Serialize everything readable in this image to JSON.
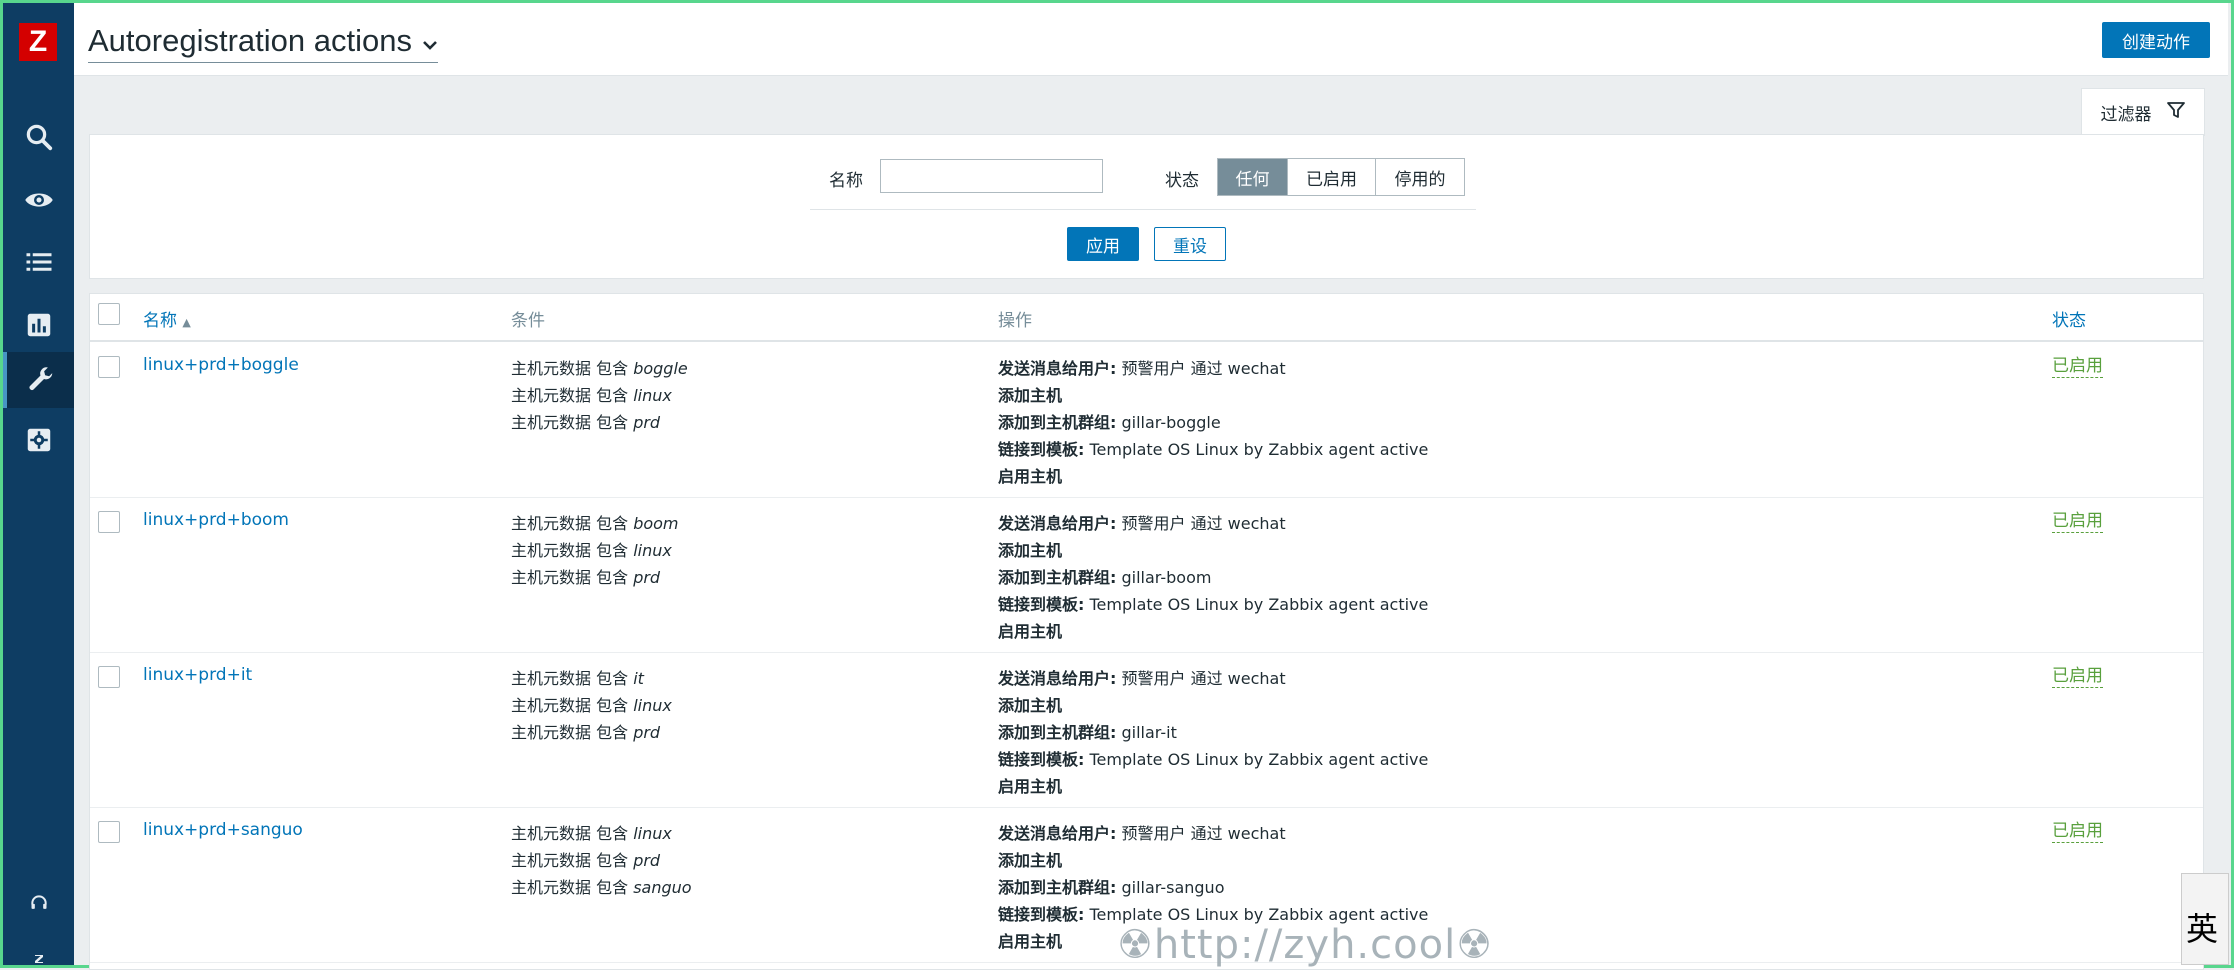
{
  "sidebar": {
    "logo": "Z",
    "items": [
      {
        "icon": "search-icon"
      },
      {
        "icon": "eye-icon"
      },
      {
        "icon": "list-icon"
      },
      {
        "icon": "chart-icon"
      },
      {
        "icon": "wrench-icon",
        "active": true
      },
      {
        "icon": "gear-icon"
      }
    ],
    "bottom": [
      {
        "icon": "headset-icon"
      },
      {
        "icon": "zabbix-icon"
      }
    ]
  },
  "header": {
    "title": "Autoregistration actions",
    "create_label": "创建动作"
  },
  "filter": {
    "tab_label": "过滤器",
    "name_label": "名称",
    "name_value": "",
    "status_label": "状态",
    "status_options": [
      "任何",
      "已启用",
      "停用的"
    ],
    "status_selected": "任何",
    "apply_label": "应用",
    "reset_label": "重设"
  },
  "table": {
    "columns": {
      "name": "名称",
      "conditions": "条件",
      "operations": "操作",
      "status": "状态"
    },
    "rows": [
      {
        "name": "linux+prd+boggle",
        "conditions": [
          {
            "prefix": "主机元数据 包含 ",
            "value": "boggle"
          },
          {
            "prefix": "主机元数据 包含 ",
            "value": "linux"
          },
          {
            "prefix": "主机元数据 包含 ",
            "value": "prd"
          }
        ],
        "operations": [
          {
            "label": "发送消息给用户:",
            "value": " 预警用户 通过 wechat"
          },
          {
            "label": "添加主机",
            "value": ""
          },
          {
            "label": "添加到主机群组:",
            "value": " gillar-boggle"
          },
          {
            "label": "链接到模板:",
            "value": " Template OS Linux by Zabbix agent active"
          },
          {
            "label": "启用主机",
            "value": ""
          }
        ],
        "status": "已启用"
      },
      {
        "name": "linux+prd+boom",
        "conditions": [
          {
            "prefix": "主机元数据 包含 ",
            "value": "boom"
          },
          {
            "prefix": "主机元数据 包含 ",
            "value": "linux"
          },
          {
            "prefix": "主机元数据 包含 ",
            "value": "prd"
          }
        ],
        "operations": [
          {
            "label": "发送消息给用户:",
            "value": " 预警用户 通过 wechat"
          },
          {
            "label": "添加主机",
            "value": ""
          },
          {
            "label": "添加到主机群组:",
            "value": " gillar-boom"
          },
          {
            "label": "链接到模板:",
            "value": " Template OS Linux by Zabbix agent active"
          },
          {
            "label": "启用主机",
            "value": ""
          }
        ],
        "status": "已启用"
      },
      {
        "name": "linux+prd+it",
        "conditions": [
          {
            "prefix": "主机元数据 包含 ",
            "value": "it"
          },
          {
            "prefix": "主机元数据 包含 ",
            "value": "linux"
          },
          {
            "prefix": "主机元数据 包含 ",
            "value": "prd"
          }
        ],
        "operations": [
          {
            "label": "发送消息给用户:",
            "value": " 预警用户 通过 wechat"
          },
          {
            "label": "添加主机",
            "value": ""
          },
          {
            "label": "添加到主机群组:",
            "value": " gillar-it"
          },
          {
            "label": "链接到模板:",
            "value": " Template OS Linux by Zabbix agent active"
          },
          {
            "label": "启用主机",
            "value": ""
          }
        ],
        "status": "已启用"
      },
      {
        "name": "linux+prd+sanguo",
        "conditions": [
          {
            "prefix": "主机元数据 包含 ",
            "value": "linux"
          },
          {
            "prefix": "主机元数据 包含 ",
            "value": "prd"
          },
          {
            "prefix": "主机元数据 包含 ",
            "value": "sanguo"
          }
        ],
        "operations": [
          {
            "label": "发送消息给用户:",
            "value": " 预警用户 通过 wechat"
          },
          {
            "label": "添加主机",
            "value": ""
          },
          {
            "label": "添加到主机群组:",
            "value": " gillar-sanguo"
          },
          {
            "label": "链接到模板:",
            "value": " Template OS Linux by Zabbix agent active"
          },
          {
            "label": "启用主机",
            "value": ""
          }
        ],
        "status": "已启用"
      }
    ]
  },
  "watermark": "☢http://zyh.cool☢",
  "ime_indicator": "英"
}
